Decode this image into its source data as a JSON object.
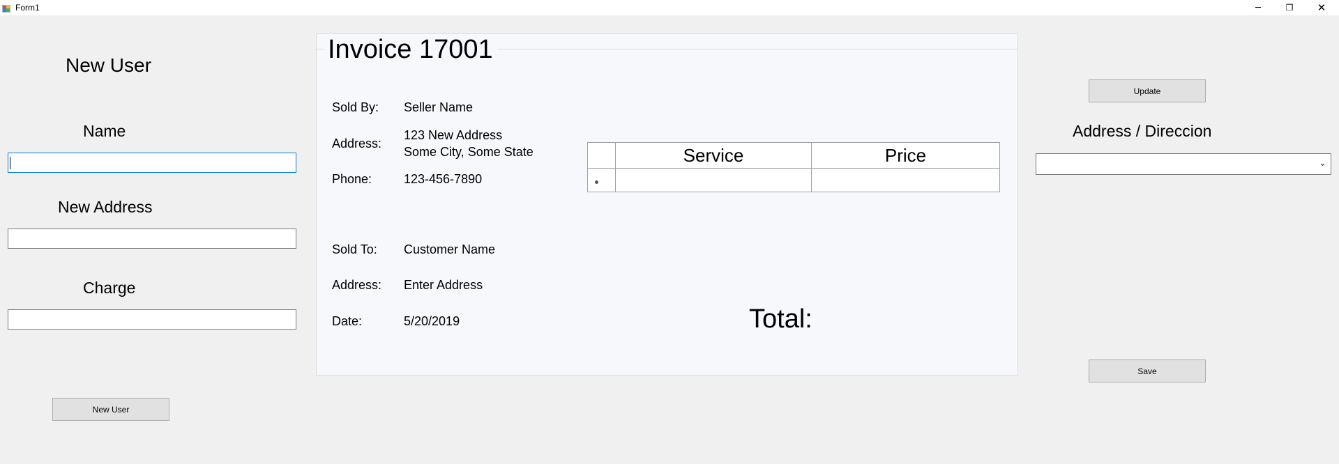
{
  "window": {
    "title": "Form1",
    "minimize_glyph": "─",
    "restore_glyph": "❐",
    "close_glyph": "✕"
  },
  "left_panel": {
    "heading": "New User",
    "name_label": "Name",
    "name_value": "",
    "address_label": "New Address",
    "address_value": "",
    "charge_label": "Charge",
    "charge_value": "",
    "new_user_button": "New User"
  },
  "invoice": {
    "title": "Invoice 17001",
    "sold_by_label": "Sold By:",
    "sold_by_value": "Seller Name",
    "seller_address_label": "Address:",
    "seller_address_line1": "123 New Address",
    "seller_address_line2": "Some City, Some State",
    "phone_label": "Phone:",
    "phone_value": "123-456-7890",
    "sold_to_label": "Sold To:",
    "sold_to_value": "Customer Name",
    "customer_address_label": "Address:",
    "customer_address_value": "Enter Address",
    "date_label": "Date:",
    "date_value": "5/20/2019",
    "total_label": "Total:",
    "grid": {
      "columns": [
        "Service",
        "Price"
      ],
      "rows": [
        {
          "service": "",
          "price": ""
        }
      ]
    }
  },
  "right_panel": {
    "update_button": "Update",
    "address_label": "Address / Direccion",
    "address_selected": "",
    "save_button": "Save"
  },
  "icons": {
    "app_icon": "form-app-icon",
    "dropdown": "chevron-down-icon",
    "new_row_marker": "new-row-icon"
  }
}
